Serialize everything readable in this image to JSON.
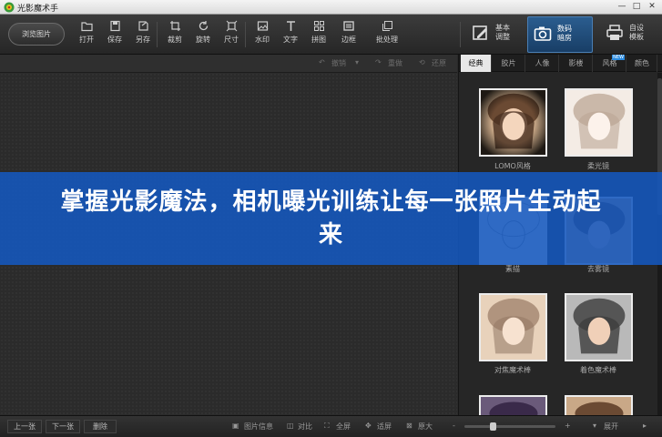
{
  "window": {
    "title": "光影魔术手",
    "min": "—",
    "max": "□",
    "close": "✕"
  },
  "toolbar": {
    "browse_label": "浏览图片",
    "buttons": [
      "打开",
      "保存",
      "另存",
      "裁剪",
      "旋转",
      "尺寸",
      "水印",
      "文字",
      "拼图",
      "边框",
      "批处理"
    ]
  },
  "modes": [
    {
      "line1": "基本",
      "line2": "调整"
    },
    {
      "line1": "数码",
      "line2": "暗房"
    },
    {
      "line1": "自设",
      "line2": "模板"
    }
  ],
  "undobar": {
    "undo": "撤销",
    "redo": "重做",
    "restore": "还原"
  },
  "panel": {
    "tabs": [
      "经典",
      "胶片",
      "人像",
      "影楼",
      "风格",
      "颜色"
    ],
    "new_badge": "NEW",
    "effects": [
      {
        "label": "LOMO风格"
      },
      {
        "label": "柔光镜"
      },
      {
        "label": "素描"
      },
      {
        "label": "去雾镜"
      },
      {
        "label": "对焦魔术棒"
      },
      {
        "label": "着色魔术棒"
      }
    ]
  },
  "status": {
    "prev": "上一张",
    "next": "下一张",
    "delete": "删除",
    "info": "图片信息",
    "compare": "对比",
    "fullscreen": "全屏",
    "fit": "适屏",
    "original": "原大",
    "minus": "-",
    "plus": "+",
    "expand": "展开"
  },
  "banner": {
    "text": "掌握光影魔法，相机曝光训练让每一张照片生动起来"
  },
  "colors": {
    "banner": "#1458be",
    "active_mode": "#2b5d8f",
    "accent": "#2a8be0"
  }
}
